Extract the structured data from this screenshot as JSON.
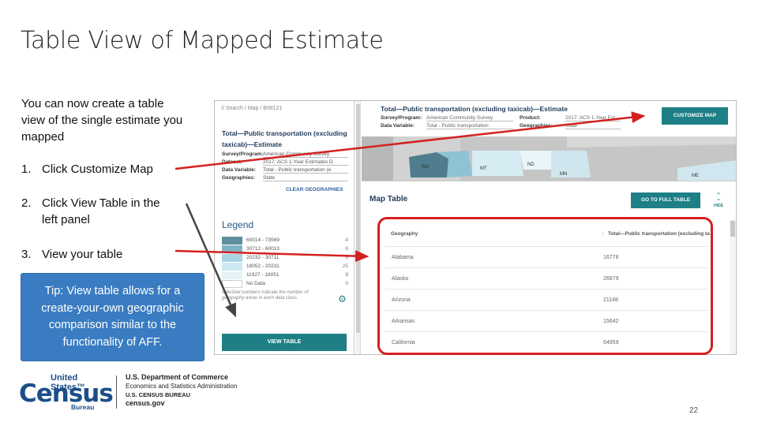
{
  "slide": {
    "title": "Table View of Mapped Estimate",
    "intro": "You can now create a table view of the single estimate you mapped",
    "steps": [
      {
        "num": "1.",
        "text": "Click Customize Map"
      },
      {
        "num": "2.",
        "text": "Click View Table in the left panel"
      },
      {
        "num": "3.",
        "text": "View your table"
      }
    ],
    "tip": "Tip: View table allows for a create-your-own geographic comparison similar to the functionality of AFF.",
    "page_number": "22"
  },
  "left_panel": {
    "breadcrumb": "// Search / Map / B08121",
    "title": "Total—Public transportation (excluding taxicab)—Estimate",
    "rows": [
      {
        "key": "Survey/Program:",
        "value": "American Community Survey"
      },
      {
        "key": "Dataset:",
        "value": "2017: ACS 1-Year Estimates D"
      },
      {
        "key": "Data Variable:",
        "value": "Total - Public transportation (e"
      },
      {
        "key": "Geographies:",
        "value": "State"
      }
    ],
    "clear_geographies": "CLEAR GEOGRAPHIES",
    "legend_title": "Legend",
    "legend_items": [
      {
        "label": "60014 - 73569",
        "count": "4",
        "color": "#5f8ea0"
      },
      {
        "label": "30712 - 60013",
        "count": "6",
        "color": "#7eb3c6"
      },
      {
        "label": "20232 - 30711",
        "count": "6",
        "color": "#a8d4e2"
      },
      {
        "label": "18052 - 20231",
        "count": "25",
        "color": "#cde8f0"
      },
      {
        "label": "11927 - 18051",
        "count": "9",
        "color": "#e4f2f6"
      },
      {
        "label": "No Data",
        "count": "0",
        "color": "#ffffff"
      }
    ],
    "legend_note": "Italicized numbers indicate the number of geography areas in each data class.",
    "view_table": "VIEW TABLE"
  },
  "right_header": {
    "title": "Total—Public transportation (excluding taxicab)—Estimate",
    "survey_key": "Survey/Program:",
    "survey_value": "American Community Survey",
    "product_key": "Product:",
    "product_value": "2017: ACS 1-Year Est",
    "variable_key": "Data Variable:",
    "variable_value": "Total - Public transportation",
    "geo_key": "Geographies:",
    "geo_value": "State",
    "customize_button": "CUSTOMIZE MAP"
  },
  "map": {
    "states": [
      "WA",
      "MT",
      "ND",
      "MN",
      "ME"
    ]
  },
  "map_table": {
    "title": "Map Table",
    "full_table_button": "GO TO FULL TABLE",
    "hide_label": "HIDE",
    "columns": [
      "Geography",
      "Total—Public transportation (excluding ta"
    ],
    "rows": [
      {
        "geo": "Alabama",
        "value": "16778"
      },
      {
        "geo": "Alaska",
        "value": "26879"
      },
      {
        "geo": "Arizona",
        "value": "21148"
      },
      {
        "geo": "Arkansas",
        "value": "15642"
      },
      {
        "geo": "California",
        "value": "64959"
      }
    ]
  },
  "footer": {
    "logo_us": "United States™",
    "logo_census": "Census",
    "logo_bureau": "Bureau",
    "dept_line1": "U.S. Department of Commerce",
    "dept_line2": "Economics and Statistics Administration",
    "dept_line3": "U.S. CENSUS BUREAU",
    "dept_line4": "census.gov"
  },
  "colors": {
    "accent_teal": "#1e7f86",
    "tip_blue": "#3a7cc1",
    "highlight_red": "#d42020",
    "logo_blue": "#1b4f8a"
  }
}
